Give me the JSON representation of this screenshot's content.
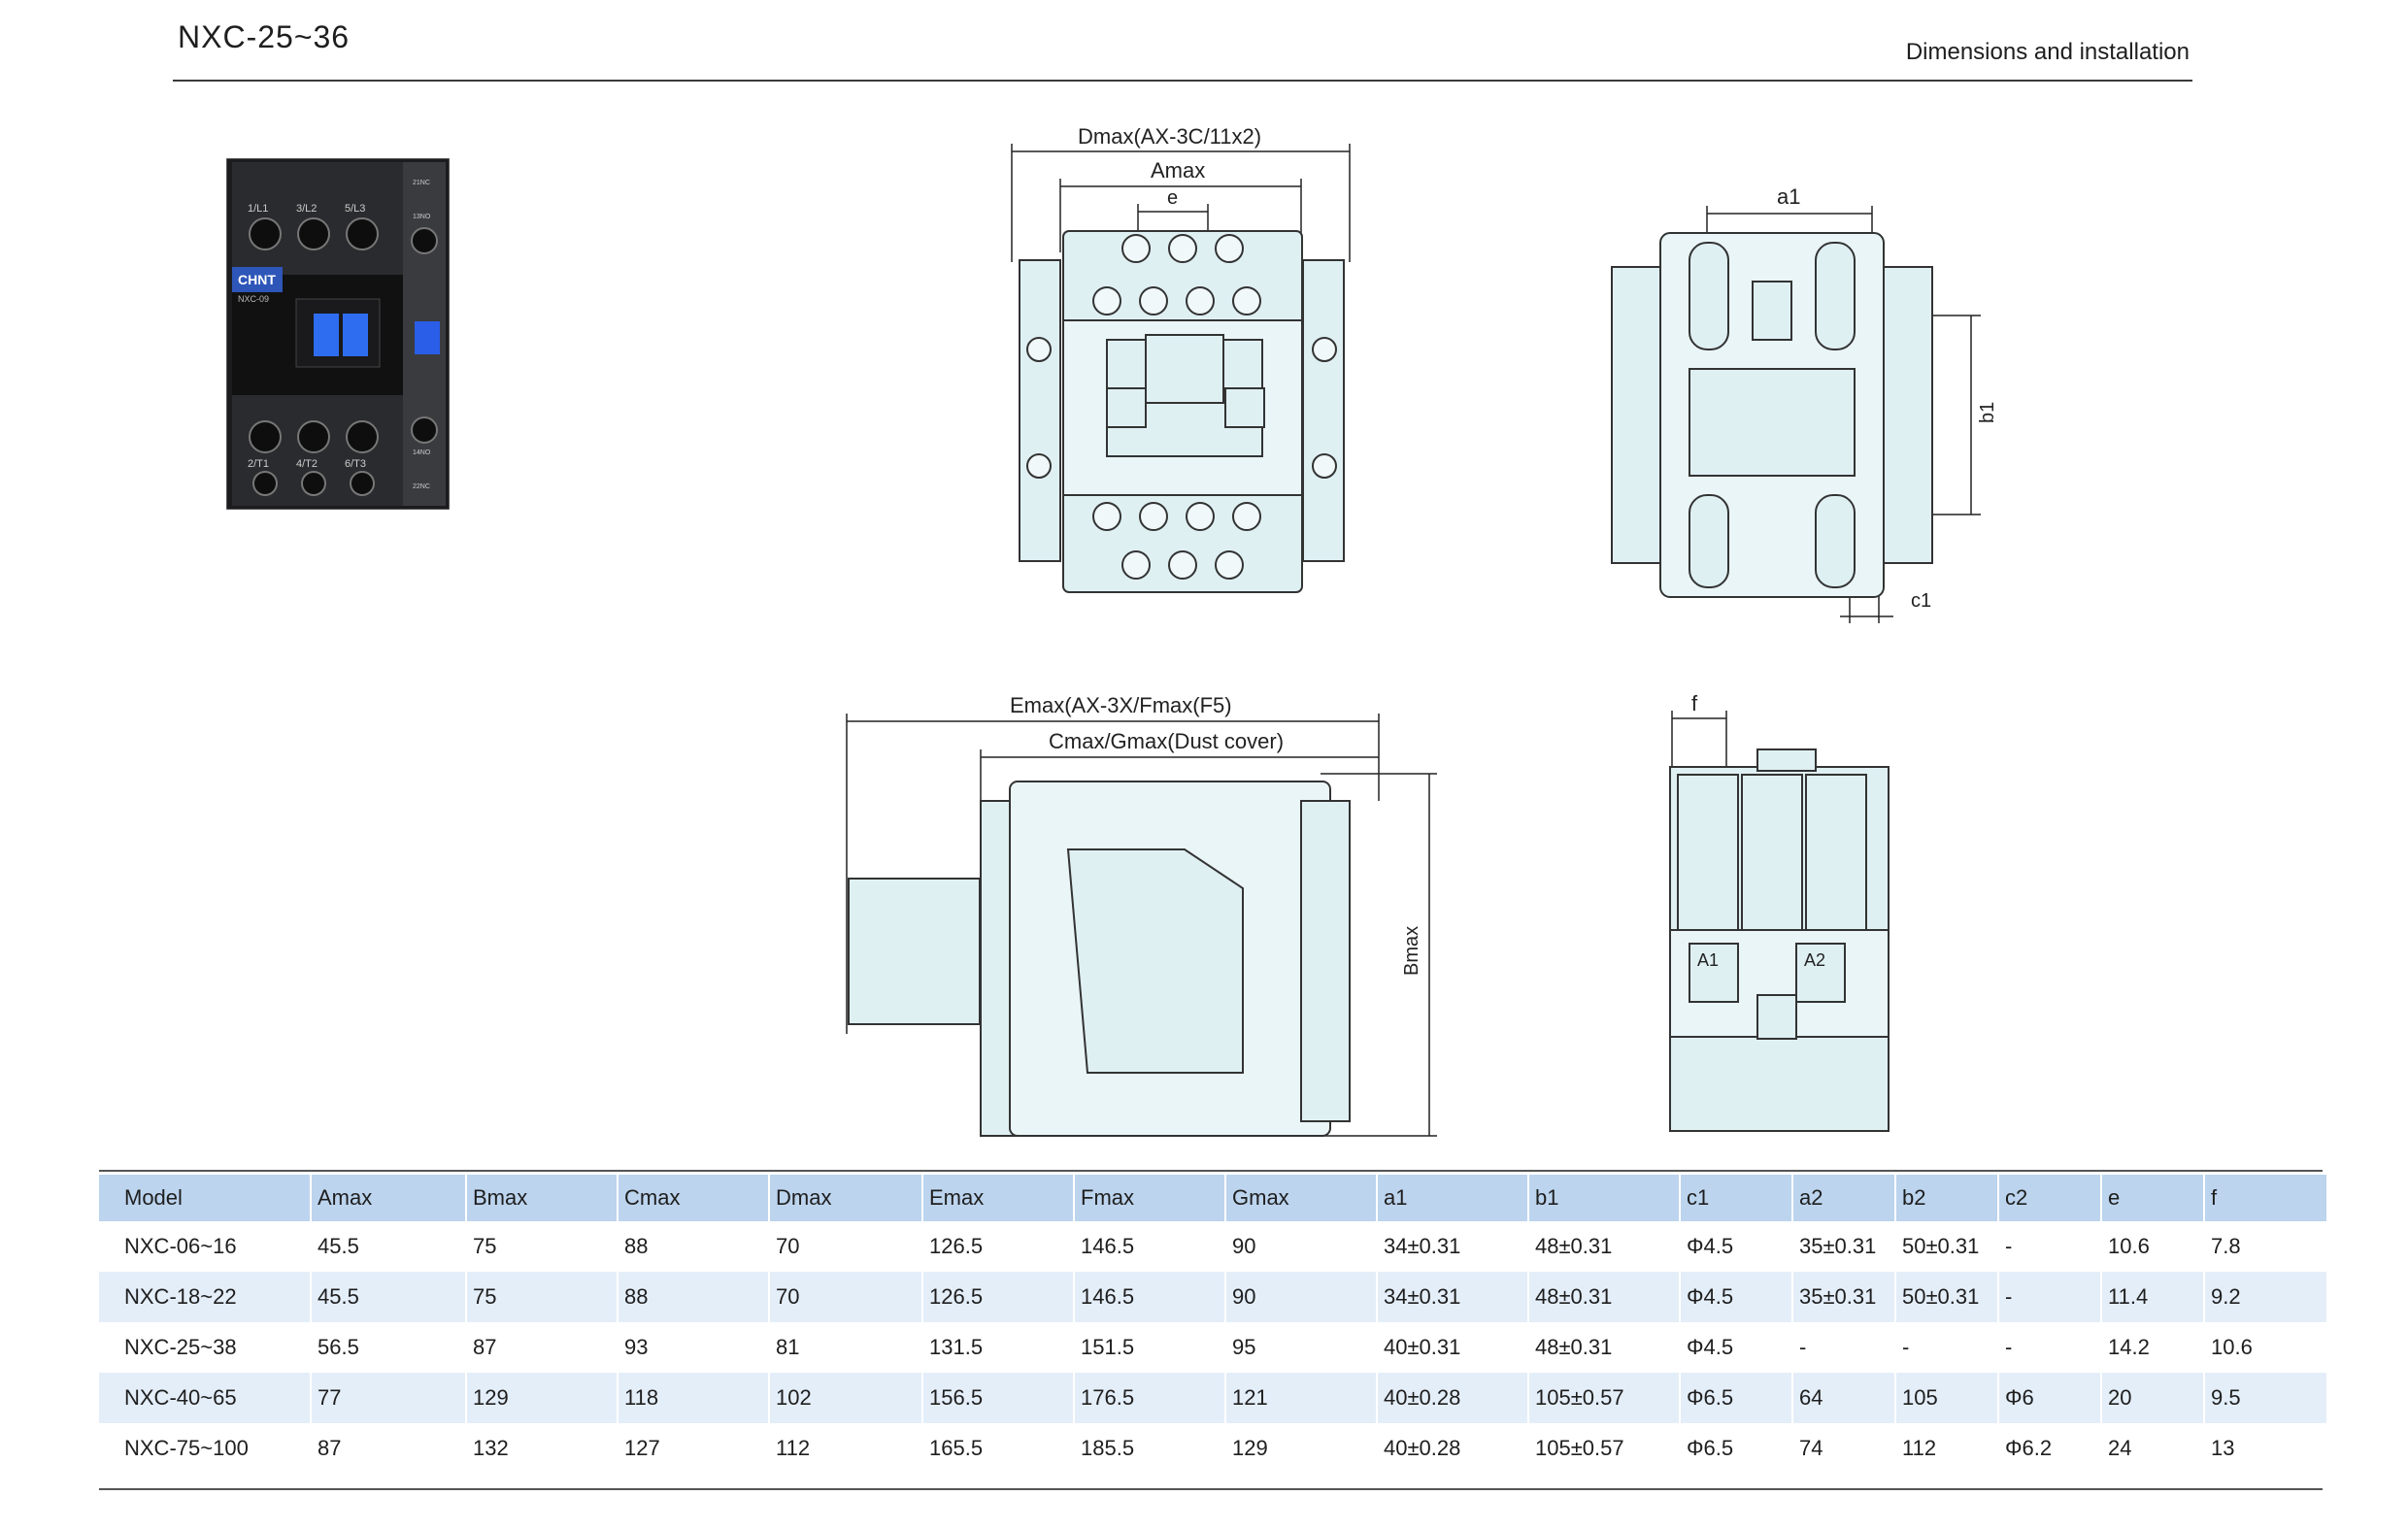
{
  "header": {
    "title": "NXC-25~36",
    "section": "Dimensions and installation"
  },
  "product_photo": {
    "brand": "CHNT",
    "model": "NXC-09",
    "terminals_top": [
      "1/L1",
      "3/L2",
      "5/L3"
    ],
    "terminals_bottom": [
      "2/T1",
      "4/T2",
      "6/T3"
    ],
    "aux_top": [
      "21NC",
      "13NO"
    ],
    "aux_bottom": [
      "14NO",
      "22NC"
    ]
  },
  "front_view": {
    "dim_top": "Dmax(AX-3C/11x2)",
    "dim_mid": "Amax",
    "dim_small": "e"
  },
  "back_view": {
    "dim_top": "a1",
    "dim_side": "b1",
    "dim_bottom": "c1"
  },
  "side_view": {
    "dim_top": "Emax(AX-3X/Fmax(F5)",
    "dim_mid": "Cmax/Gmax(Dust cover)",
    "dim_side": "Bmax"
  },
  "end_view": {
    "dim_top": "f",
    "coil_left": "A1",
    "coil_right": "A2"
  },
  "table": {
    "headers": [
      "Model",
      "Amax",
      "Bmax",
      "Cmax",
      "Dmax",
      "Emax",
      "Fmax",
      "Gmax",
      "a1",
      "b1",
      "c1",
      "a2",
      "b2",
      "c2",
      "e",
      "f"
    ],
    "rows": [
      [
        "NXC-06~16",
        "45.5",
        "75",
        "88",
        "70",
        "126.5",
        "146.5",
        "90",
        "34±0.31",
        "48±0.31",
        "Φ4.5",
        "35±0.31",
        "50±0.31",
        "-",
        "10.6",
        "7.8"
      ],
      [
        "NXC-18~22",
        "45.5",
        "75",
        "88",
        "70",
        "126.5",
        "146.5",
        "90",
        "34±0.31",
        "48±0.31",
        "Φ4.5",
        "35±0.31",
        "50±0.31",
        "-",
        "11.4",
        "9.2"
      ],
      [
        "NXC-25~38",
        "56.5",
        "87",
        "93",
        "81",
        "131.5",
        "151.5",
        "95",
        "40±0.31",
        "48±0.31",
        "Φ4.5",
        "-",
        "-",
        "-",
        "14.2",
        "10.6"
      ],
      [
        "NXC-40~65",
        "77",
        "129",
        "118",
        "102",
        "156.5",
        "176.5",
        "121",
        "40±0.28",
        "105±0.57",
        "Φ6.5",
        "64",
        "105",
        "Φ6",
        "20",
        "9.5"
      ],
      [
        "NXC-75~100",
        "87",
        "132",
        "127",
        "112",
        "165.5",
        "185.5",
        "129",
        "40±0.28",
        "105±0.57",
        "Φ6.5",
        "74",
        "112",
        "Φ6.2",
        "24",
        "13"
      ]
    ]
  }
}
